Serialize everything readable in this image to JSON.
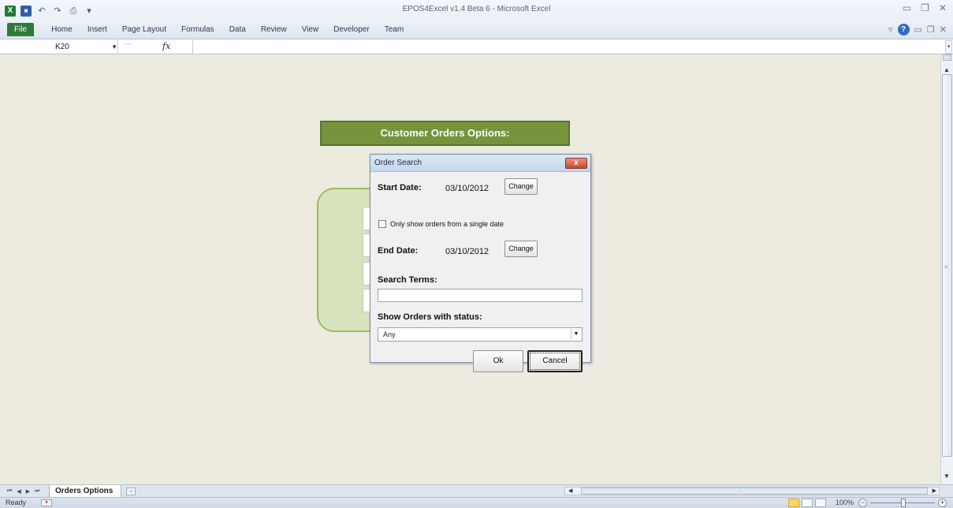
{
  "window": {
    "title": "EPOS4Excel v1.4 Beta 6 - Microsoft Excel"
  },
  "ribbon": {
    "tabs": [
      "File",
      "Home",
      "Insert",
      "Page Layout",
      "Formulas",
      "Data",
      "Review",
      "View",
      "Developer",
      "Team"
    ]
  },
  "formula_bar": {
    "name_box": "K20",
    "fx": "fx",
    "formula": ""
  },
  "sheet": {
    "header_label": "Customer Orders Options:"
  },
  "dialog": {
    "title": "Order Search",
    "close": "x",
    "start_date_label": "Start Date:",
    "start_date_value": "03/10/2012",
    "change_label": "Change",
    "single_date_label": "Only show orders from a single date",
    "single_date_checked": false,
    "end_date_label": "End Date:",
    "end_date_value": "03/10/2012",
    "search_terms_label": "Search Terms:",
    "search_terms_value": "",
    "status_label": "Show Orders with status:",
    "status_value": "Any",
    "ok_label": "Ok",
    "cancel_label": "Cancel"
  },
  "tabs_bar": {
    "sheet_tab": "Orders Options"
  },
  "status": {
    "ready": "Ready",
    "zoom": "100%"
  },
  "icons": {
    "excel": "excel-icon",
    "save": "save-icon",
    "undo": "undo-icon",
    "redo": "redo-icon",
    "print": "print-icon"
  },
  "colors": {
    "header_green": "#77933c",
    "shape_green": "#d7e4bd",
    "file_tab": "#2d7a3a"
  }
}
